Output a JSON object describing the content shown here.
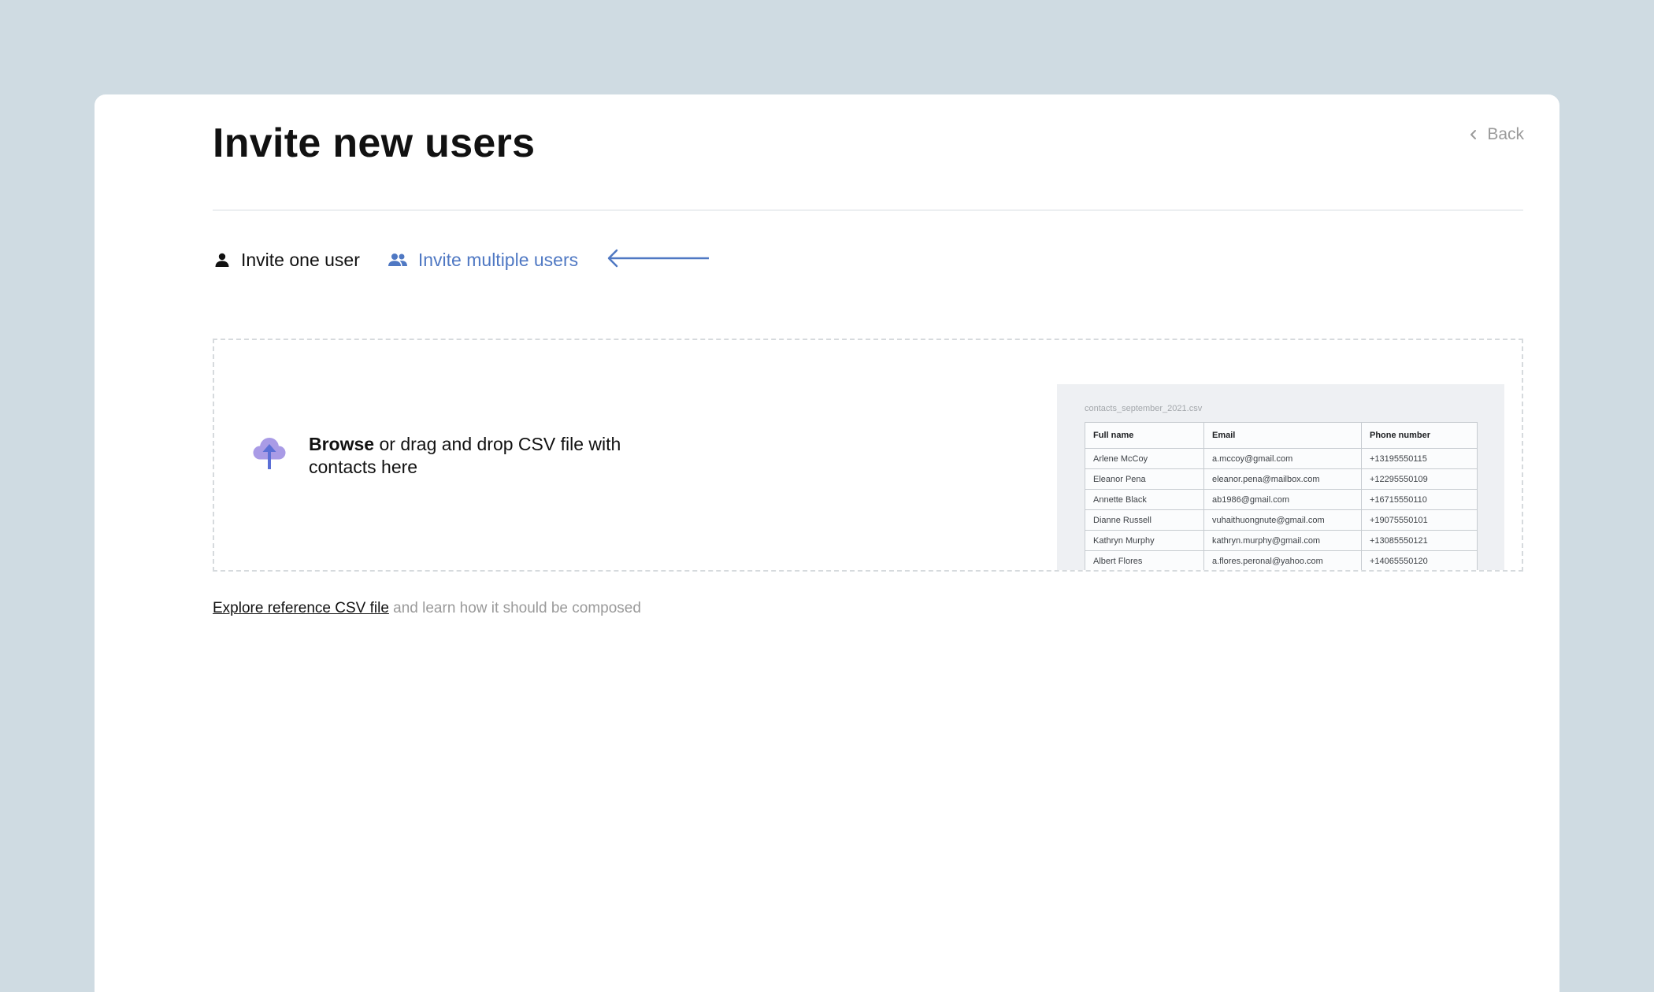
{
  "page": {
    "title": "Invite new users",
    "back_label": "Back"
  },
  "tabs": [
    {
      "label": "Invite one user",
      "icon": "person-icon",
      "active": false
    },
    {
      "label": "Invite multiple users",
      "icon": "people-icon",
      "active": true
    }
  ],
  "dropzone": {
    "browse_label": "Browse",
    "text_rest": " or drag and drop CSV file with contacts here",
    "icon": "cloud-upload-icon"
  },
  "csv_preview": {
    "filename": "contacts_september_2021.csv",
    "columns": [
      "Full name",
      "Email",
      "Phone number"
    ],
    "rows": [
      [
        "Arlene McCoy",
        "a.mccoy@gmail.com",
        "+13195550115"
      ],
      [
        "Eleanor Pena",
        "eleanor.pena@mailbox.com",
        "+12295550109"
      ],
      [
        "Annette Black",
        "ab1986@gmail.com",
        "+16715550110"
      ],
      [
        "Dianne Russell",
        "vuhaithuongnute@gmail.com",
        "+19075550101"
      ],
      [
        "Kathryn Murphy",
        "kathryn.murphy@gmail.com",
        "+13085550121"
      ],
      [
        "Albert Flores",
        "a.flores.peronal@yahoo.com",
        "+14065550120"
      ]
    ]
  },
  "reference": {
    "link_label": "Explore reference CSV file",
    "rest": " and learn how it should be composed"
  },
  "colors": {
    "background": "#cfdbe2",
    "accent": "#4f78c3",
    "upload_cloud": "#a99be6",
    "upload_arrow": "#5b6fd6",
    "muted_text": "#9a9a9a"
  }
}
